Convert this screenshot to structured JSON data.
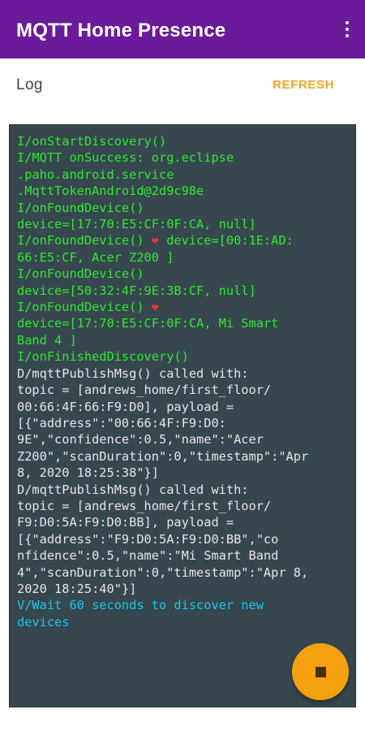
{
  "app": {
    "title": "MQTT Home Presence"
  },
  "header": {
    "log_label": "Log",
    "refresh_label": "REFRESH"
  },
  "icons": {
    "overflow": "more-vertical-icon",
    "heart": "heart-icon",
    "stop": "stop-icon"
  },
  "colors": {
    "app_bar": "#6a1b9a",
    "accent": "#f5a623",
    "console_bg": "#37474f",
    "info_text": "#2ee82e",
    "debug_text": "#e6e6e6",
    "verbose_text": "#18c6e6",
    "heart": "#e53935"
  },
  "log": {
    "lines": [
      {
        "level": "i",
        "text": "I/onStartDiscovery()"
      },
      {
        "level": "i",
        "text": "I/MQTT onSuccess: org.eclipse"
      },
      {
        "level": "i",
        "text": ".paho.android.service"
      },
      {
        "level": "i",
        "text": ".MqttTokenAndroid@2d9c98e"
      },
      {
        "level": "i",
        "text": "I/onFoundDevice()"
      },
      {
        "level": "i",
        "text": "device=[17:70:E5:CF:0F:CA, null]"
      },
      {
        "level": "i",
        "text": "I/onFoundDevice() ",
        "heart": "❤",
        "after": " device=[00:1E:AD:"
      },
      {
        "level": "i",
        "text": "66:E5:CF, Acer Z200 ]"
      },
      {
        "level": "i",
        "text": "I/onFoundDevice()"
      },
      {
        "level": "i",
        "text": "device=[50:32:4F:9E:3B:CF, null]"
      },
      {
        "level": "i",
        "text": "I/onFoundDevice() ",
        "heart": "❤",
        "after": ""
      },
      {
        "level": "i",
        "text": "device=[17:70:E5:CF:0F:CA, Mi Smart"
      },
      {
        "level": "i",
        "text": "Band 4 ]"
      },
      {
        "level": "i",
        "text": "I/onFinishedDiscovery()"
      },
      {
        "level": "d",
        "text": "D/mqttPublishMsg() called with:"
      },
      {
        "level": "d",
        "text": "topic = [andrews_home/first_floor/"
      },
      {
        "level": "d",
        "text": "00:66:4F:66:F9:D0], payload ="
      },
      {
        "level": "d",
        "text": "[{\"address\":\"00:66:4F:F9:D0:"
      },
      {
        "level": "d",
        "text": "9E\",\"confidence\":0.5,\"name\":\"Acer"
      },
      {
        "level": "d",
        "text": "Z200\",\"scanDuration\":0,\"timestamp\":\"Apr"
      },
      {
        "level": "d",
        "text": "8, 2020 18:25:38\"}]"
      },
      {
        "level": "d",
        "text": "D/mqttPublishMsg() called with:"
      },
      {
        "level": "d",
        "text": "topic = [andrews_home/first_floor/"
      },
      {
        "level": "d",
        "text": "F9:D0:5A:F9:D0:BB], payload ="
      },
      {
        "level": "d",
        "text": "[{\"address\":\"F9:D0:5A:F9:D0:BB\",\"co"
      },
      {
        "level": "d",
        "text": "nfidence\":0.5,\"name\":\"Mi Smart Band"
      },
      {
        "level": "d",
        "text": "4\",\"scanDuration\":0,\"timestamp\":\"Apr 8,"
      },
      {
        "level": "d",
        "text": "2020 18:25:40\"}]"
      },
      {
        "level": "v",
        "text": "V/Wait 60 seconds to discover new"
      },
      {
        "level": "v",
        "text": "devices"
      }
    ]
  }
}
